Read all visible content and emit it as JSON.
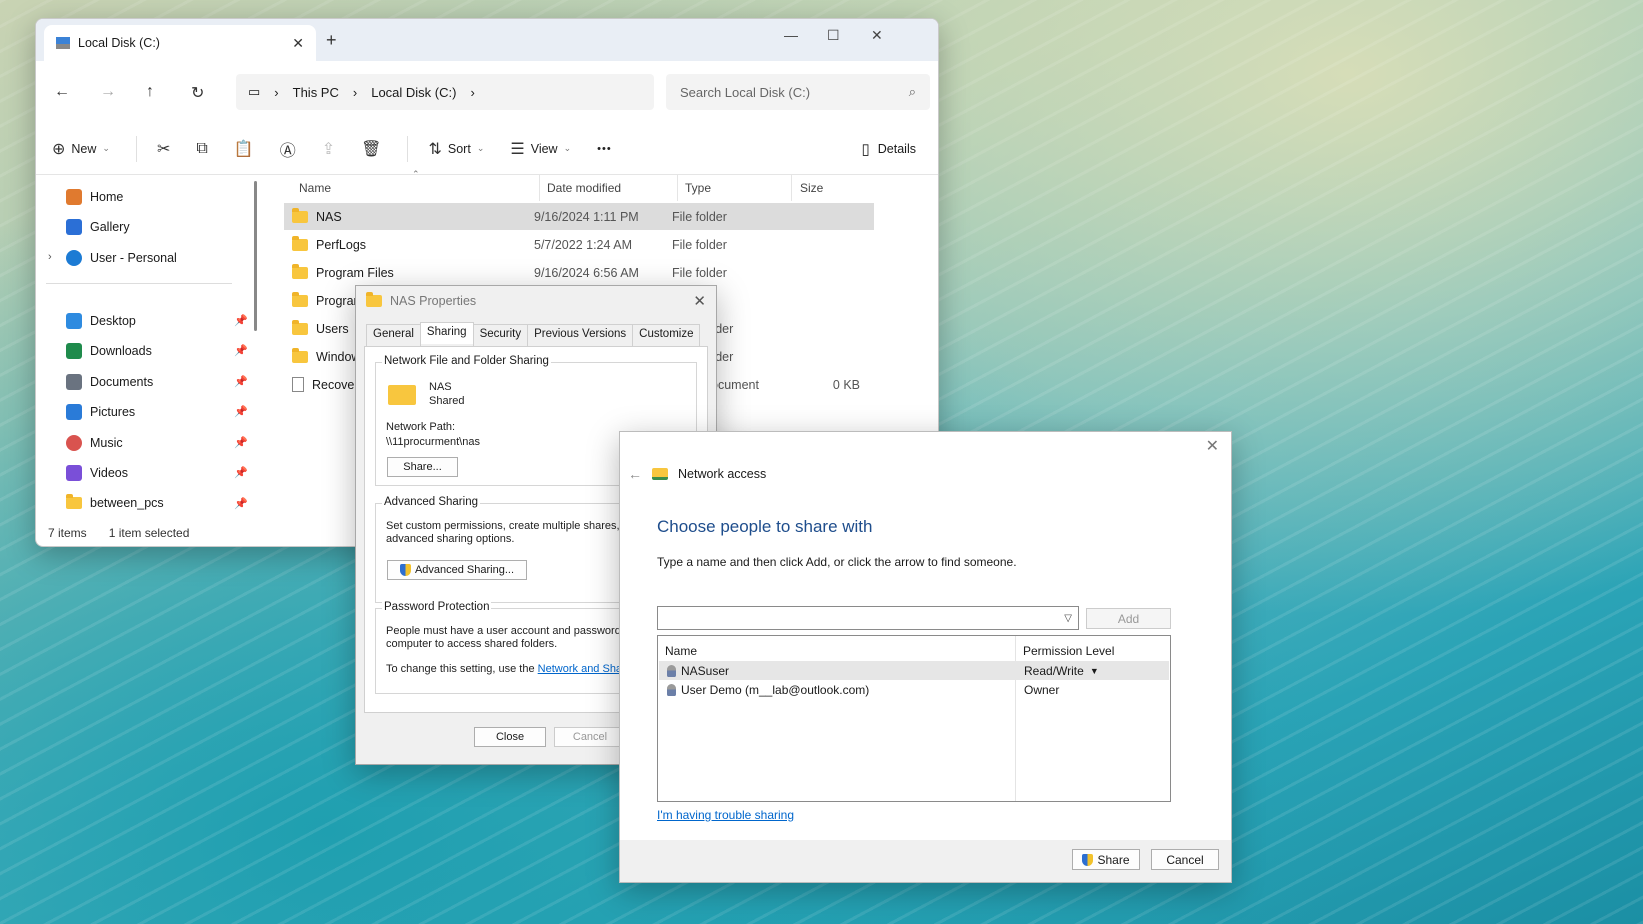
{
  "explorer": {
    "tab_title": "Local Disk (C:)",
    "breadcrumb": [
      "This PC",
      "Local Disk (C:)"
    ],
    "search_placeholder": "Search Local Disk (C:)",
    "toolbar": {
      "new": "New",
      "sort": "Sort",
      "view": "View",
      "more": "•••",
      "details": "Details"
    },
    "sidebar": {
      "top": [
        {
          "label": "Home",
          "icon": "home-icon",
          "color": "#e07a2f"
        },
        {
          "label": "Gallery",
          "icon": "gallery-icon",
          "color": "#2b6fd6"
        },
        {
          "label": "User - Personal",
          "icon": "cloud-icon",
          "color": "#1c7bd4"
        }
      ],
      "pinned": [
        {
          "label": "Desktop",
          "icon": "desktop-icon",
          "color": "#2e8be0"
        },
        {
          "label": "Downloads",
          "icon": "download-icon",
          "color": "#1f8b4c"
        },
        {
          "label": "Documents",
          "icon": "documents-icon",
          "color": "#6a7380"
        },
        {
          "label": "Pictures",
          "icon": "pictures-icon",
          "color": "#2a7bd8"
        },
        {
          "label": "Music",
          "icon": "music-icon",
          "color": "#d9534f"
        },
        {
          "label": "Videos",
          "icon": "videos-icon",
          "color": "#7a4fd8"
        },
        {
          "label": "between_pcs",
          "icon": "folder-icon",
          "color": "#f8c63e"
        }
      ]
    },
    "columns": [
      "Name",
      "Date modified",
      "Type",
      "Size"
    ],
    "rows": [
      {
        "name": "NAS",
        "date": "9/16/2024 1:11 PM",
        "type": "File folder",
        "size": ""
      },
      {
        "name": "PerfLogs",
        "date": "5/7/2022 1:24 AM",
        "type": "File folder",
        "size": ""
      },
      {
        "name": "Program Files",
        "date": "9/16/2024 6:56 AM",
        "type": "File folder",
        "size": ""
      },
      {
        "name": "Program Fi",
        "date": "",
        "type": "",
        "size": ""
      },
      {
        "name": "Users",
        "date": "",
        "type": "folder",
        "size": ""
      },
      {
        "name": "Windows",
        "date": "",
        "type": "folder",
        "size": ""
      },
      {
        "name": "Recovery",
        "date": "",
        "type": "Document",
        "size": "0 KB"
      }
    ],
    "status": {
      "count": "7 items",
      "selected": "1 item selected"
    }
  },
  "props": {
    "title": "NAS Properties",
    "tabs": [
      "General",
      "Sharing",
      "Security",
      "Previous Versions",
      "Customize"
    ],
    "network_group": "Network File and Folder Sharing",
    "folder_name": "NAS",
    "folder_state": "Shared",
    "path_label": "Network Path:",
    "path": "\\\\11procurment\\nas",
    "share_btn": "Share...",
    "adv_group": "Advanced Sharing",
    "adv_text1": "Set custom permissions, create multiple shares, ar",
    "adv_text2": "advanced sharing options.",
    "adv_btn": "Advanced Sharing...",
    "pwd_group": "Password Protection",
    "pwd_text1": "People must have a user account and password f",
    "pwd_text2": "computer to access shared folders.",
    "pwd_text3": "To change this setting, use the",
    "pwd_link": "Network and Sha",
    "close": "Close",
    "cancel": "Cancel"
  },
  "net": {
    "header": "Network access",
    "title": "Choose people to share with",
    "instruction": "Type a name and then click Add, or click the arrow to find someone.",
    "add": "Add",
    "col_name": "Name",
    "col_perm": "Permission Level",
    "users": [
      {
        "name": "NASuser",
        "perm": "Read/Write"
      },
      {
        "name": "User Demo (m__lab@outlook.com)",
        "perm": "Owner"
      }
    ],
    "trouble": "I'm having trouble sharing",
    "share": "Share",
    "cancel": "Cancel"
  }
}
